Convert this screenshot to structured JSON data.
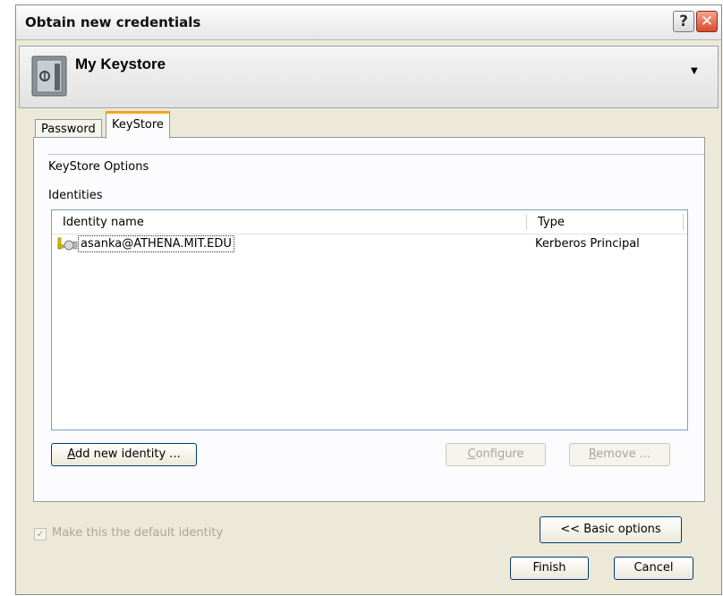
{
  "window": {
    "title": "Obtain new credentials",
    "help_glyph": "?",
    "close_glyph": "✕"
  },
  "header": {
    "keystore_title": "My Keystore",
    "icon": "safe-icon",
    "dropdown_glyph": "▼"
  },
  "tabs": [
    {
      "label": "Password",
      "active": false
    },
    {
      "label": "KeyStore",
      "active": true
    }
  ],
  "keystore": {
    "options_heading": "KeyStore Options",
    "identities_label": "Identities",
    "columns": [
      "Identity name",
      "Type"
    ],
    "rows": [
      {
        "name": "asanka@ATHENA.MIT.EDU",
        "type": "Kerberos Principal",
        "icon": "key-icon"
      }
    ],
    "add_button": "Add new identity ...",
    "configure_button": "Configure",
    "remove_button": "Remove ..."
  },
  "footer": {
    "default_checkbox_label": "Make this the default identity",
    "default_checked": true,
    "basic_options_button": "<< Basic options",
    "finish_button": "Finish",
    "cancel_button": "Cancel"
  },
  "colors": {
    "tab_accent": "#f4a51c",
    "dialog_bg": "#ece9d8",
    "button_border": "#003c74"
  }
}
